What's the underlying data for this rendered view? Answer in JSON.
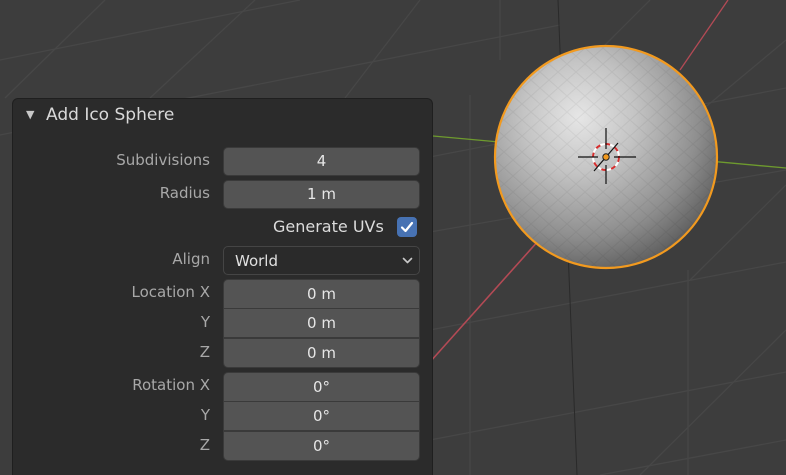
{
  "panel": {
    "title": "Add Ico Sphere",
    "collapse_glyph": "▼",
    "subdivisions": {
      "label": "Subdivisions",
      "value": "4"
    },
    "radius": {
      "label": "Radius",
      "value": "1 m"
    },
    "generate_uvs": {
      "label": "Generate UVs",
      "checked": true
    },
    "align": {
      "label": "Align",
      "value": "World"
    },
    "location": {
      "label_x": "Location X",
      "label_y": "Y",
      "label_z": "Z",
      "x": "0 m",
      "y": "0 m",
      "z": "0 m"
    },
    "rotation": {
      "label_x": "Rotation X",
      "label_y": "Y",
      "label_z": "Z",
      "x": "0°",
      "y": "0°",
      "z": "0°"
    }
  },
  "colors": {
    "viewport_bg": "#3d3d3d",
    "grid_line": "#454545",
    "x_axis": "#b34a55",
    "y_axis": "#6e9b2e",
    "selection_outline": "#f29a1f",
    "checkbox_accent": "#4772b3"
  },
  "icons": {
    "checkbox": "checkmark-icon",
    "dropdown": "chevron-down-icon",
    "cursor": "3d-cursor-icon",
    "origin": "object-origin-icon"
  }
}
